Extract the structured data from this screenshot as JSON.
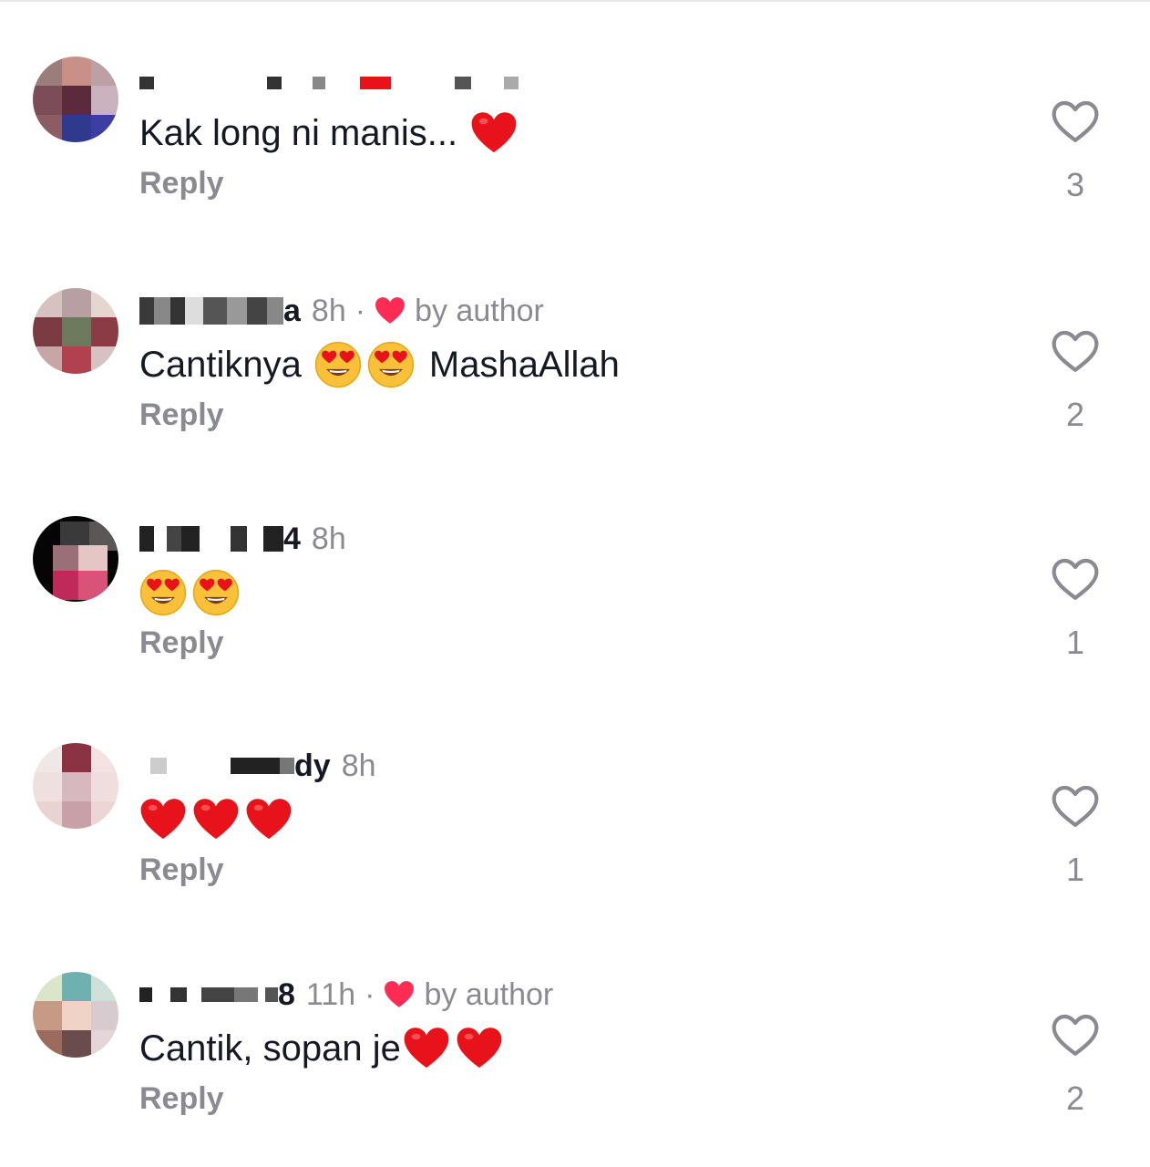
{
  "comments": [
    {
      "username_tail": "",
      "time": "",
      "by_author": "",
      "text": "Kak long ni manis...",
      "emojis": [
        "red-heart"
      ],
      "reply_label": "Reply",
      "likes": "3"
    },
    {
      "username_tail": "a",
      "time": "8h",
      "by_author": "by author",
      "text": "Cantiknya",
      "emojis": [
        "heart-eyes",
        "heart-eyes"
      ],
      "text_after": "MashaAllah",
      "reply_label": "Reply",
      "likes": "2"
    },
    {
      "username_tail": "4",
      "time": "8h",
      "by_author": "",
      "text": "",
      "emojis": [
        "heart-eyes",
        "heart-eyes"
      ],
      "reply_label": "Reply",
      "likes": "1"
    },
    {
      "username_tail": "dy",
      "time": "8h",
      "by_author": "",
      "text": "",
      "emojis": [
        "red-heart",
        "red-heart",
        "red-heart"
      ],
      "reply_label": "Reply",
      "likes": "1"
    },
    {
      "username_tail": "8",
      "time": "11h",
      "by_author": "by author",
      "text": "Cantik, sopan je",
      "emojis": [
        "red-heart",
        "red-heart"
      ],
      "reply_label": "Reply",
      "likes": "2"
    }
  ],
  "colors": {
    "primary_text": "#161823",
    "secondary_text": "#8a8b91",
    "like_red": "#fe2c55",
    "heart_emoji": "#e8131a"
  }
}
